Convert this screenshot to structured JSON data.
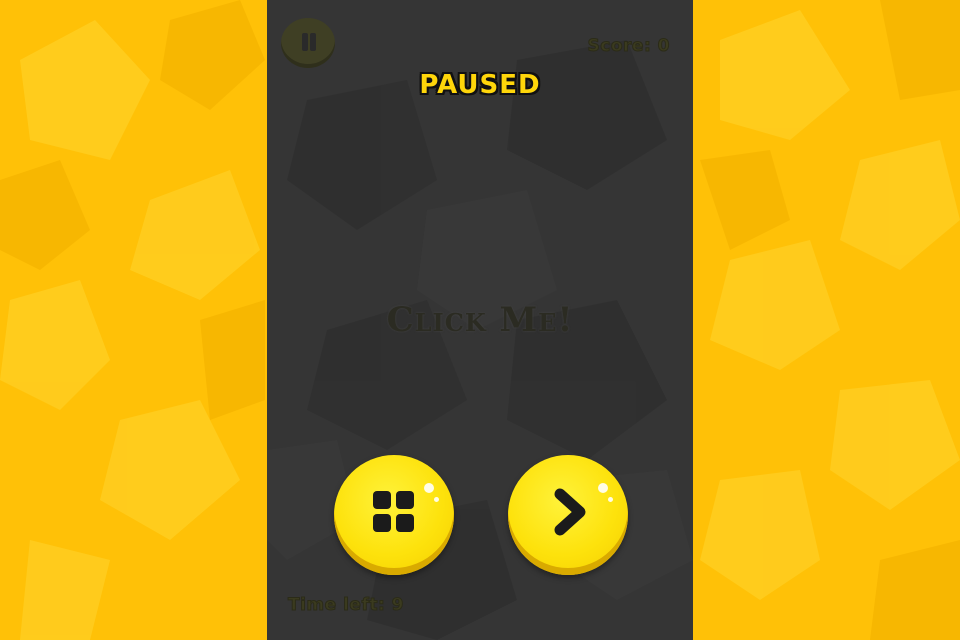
{
  "hud": {
    "score_text": "Score: 0",
    "time_text": "Time left: 9"
  },
  "overlay": {
    "title": "PAUSED"
  },
  "game": {
    "target_text": "Click Me!"
  },
  "buttons": {
    "pause_icon": "pause-icon",
    "menu_icon": "grid-menu-icon",
    "resume_icon": "chevron-right-icon"
  },
  "colors": {
    "background_yellow": "#ffc107",
    "panel_dark": "#353535",
    "button_yellow": "#fde20c",
    "title_yellow": "#ffd60a"
  }
}
